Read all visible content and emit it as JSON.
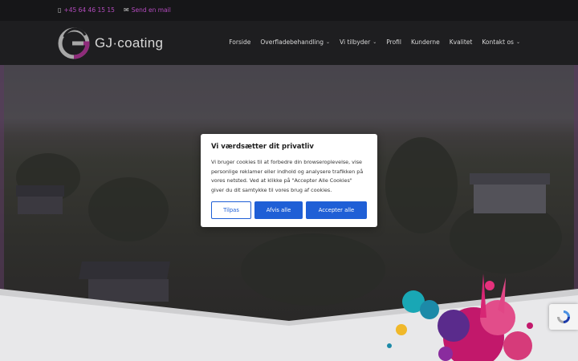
{
  "topbar": {
    "phone": "+45 64 46 15 15",
    "phone_icon": "mobile-phone-icon",
    "email": "Send en mail",
    "email_icon": "envelope-icon"
  },
  "header": {
    "logo_text": "GJ·coating",
    "nav": [
      {
        "label": "Forside",
        "has_dropdown": false
      },
      {
        "label": "Overfladebehandling",
        "has_dropdown": true
      },
      {
        "label": "Vi tilbyder",
        "has_dropdown": true
      },
      {
        "label": "Profil",
        "has_dropdown": false
      },
      {
        "label": "Kunderne",
        "has_dropdown": false
      },
      {
        "label": "Kvalitet",
        "has_dropdown": false
      },
      {
        "label": "Kontakt os",
        "has_dropdown": true
      }
    ]
  },
  "cookie_modal": {
    "title": "Vi værdsætter dit privatliv",
    "body_lines": [
      "Vi bruger cookies til at forbedre din browseroplevelse, vise",
      "personlige reklamer eller indhold og analysere trafikken på",
      "vores netsted. Ved at klikke på \"Accepter Alle Cookies\"",
      "giver du dit samtykke til vores brug af cookies."
    ],
    "customize_label": "Tilpas",
    "reject_label": "Afvis alle",
    "accept_label": "Accepter alle"
  },
  "colors": {
    "accent_purple": "#b34bbd",
    "button_blue": "#1f5fd6",
    "logo_magenta": "#8e2b7a",
    "logo_gray": "#a7a7a7"
  },
  "recaptcha": {
    "icon": "recaptcha-icon"
  }
}
